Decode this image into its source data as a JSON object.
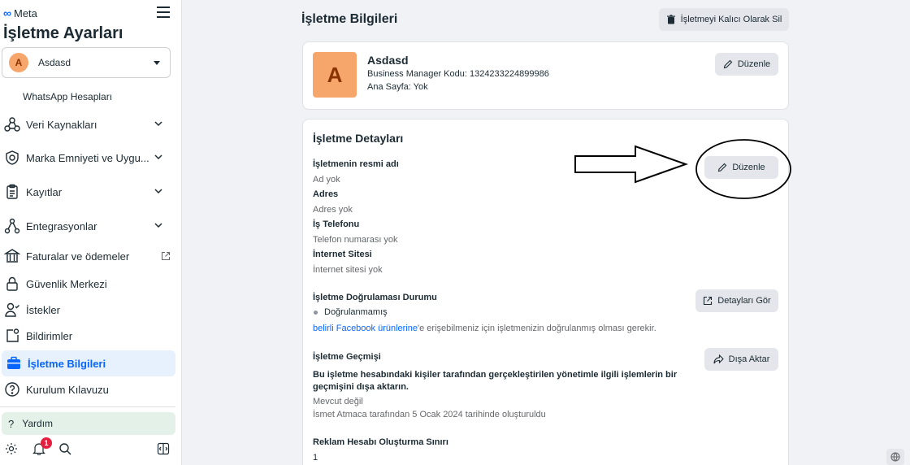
{
  "sidebar": {
    "logo_text": "Meta",
    "title": "İşletme Ayarları",
    "account": {
      "initial": "A",
      "name": "Asdasd"
    },
    "sub_item": "WhatsApp Hesapları",
    "items": [
      {
        "label": "Veri Kaynakları"
      },
      {
        "label": "Marka Emniyeti ve Uygu..."
      },
      {
        "label": "Kayıtlar"
      },
      {
        "label": "Entegrasyonlar"
      },
      {
        "label": "Faturalar ve ödemeler"
      },
      {
        "label": "Güvenlik Merkezi"
      },
      {
        "label": "İstekler"
      },
      {
        "label": "Bildirimler"
      },
      {
        "label": "İşletme Bilgileri"
      },
      {
        "label": "Kurulum Kılavuzu"
      }
    ],
    "help_label": "Yardım",
    "notification_count": "1"
  },
  "main": {
    "page_title": "İşletme Bilgileri",
    "delete_button": "İşletmeyi Kalıcı Olarak Sil",
    "profile": {
      "initial": "A",
      "name": "Asdasd",
      "manager_code": "Business Manager Kodu: 1324233224899986",
      "home_page": "Ana Sayfa: Yok",
      "edit_button": "Düzenle"
    },
    "details": {
      "title": "İşletme Detayları",
      "edit_button": "Düzenle",
      "legal_name_label": "İşletmenin resmi adı",
      "legal_name_value": "Ad yok",
      "address_label": "Adres",
      "address_value": "Adres yok",
      "phone_label": "İş Telefonu",
      "phone_value": "Telefon numarası yok",
      "website_label": "İnternet Sitesi",
      "website_value": "İnternet sitesi yok",
      "verification_label": "İşletme Doğrulaması Durumu",
      "verification_status": "Doğrulanmamış",
      "verification_button": "Detayları Gör",
      "verification_note_link": "belirli Facebook ürünlerine",
      "verification_note_rest": "'e erişebilmeniz için işletmenizin doğrulanmış olması gerekir.",
      "history_label": "İşletme Geçmişi",
      "history_button": "Dışa Aktar",
      "history_desc": "Bu işletme hesabındaki kişiler tarafından gerçekleştirilen yönetimle ilgili işlemlerin bir geçmişini dışa aktarın.",
      "history_status": "Mevcut değil",
      "history_created": "İsmet Atmaca tarafından 5 Ocak 2024 tarihinde oluşturuldu",
      "ad_limit_label": "Reklam Hesabı Oluşturma Sınırı",
      "ad_limit_value": "1"
    }
  },
  "colors": {
    "accent": "#0866ff",
    "avatar": "#f7a66b",
    "badge": "#e41e3f"
  }
}
